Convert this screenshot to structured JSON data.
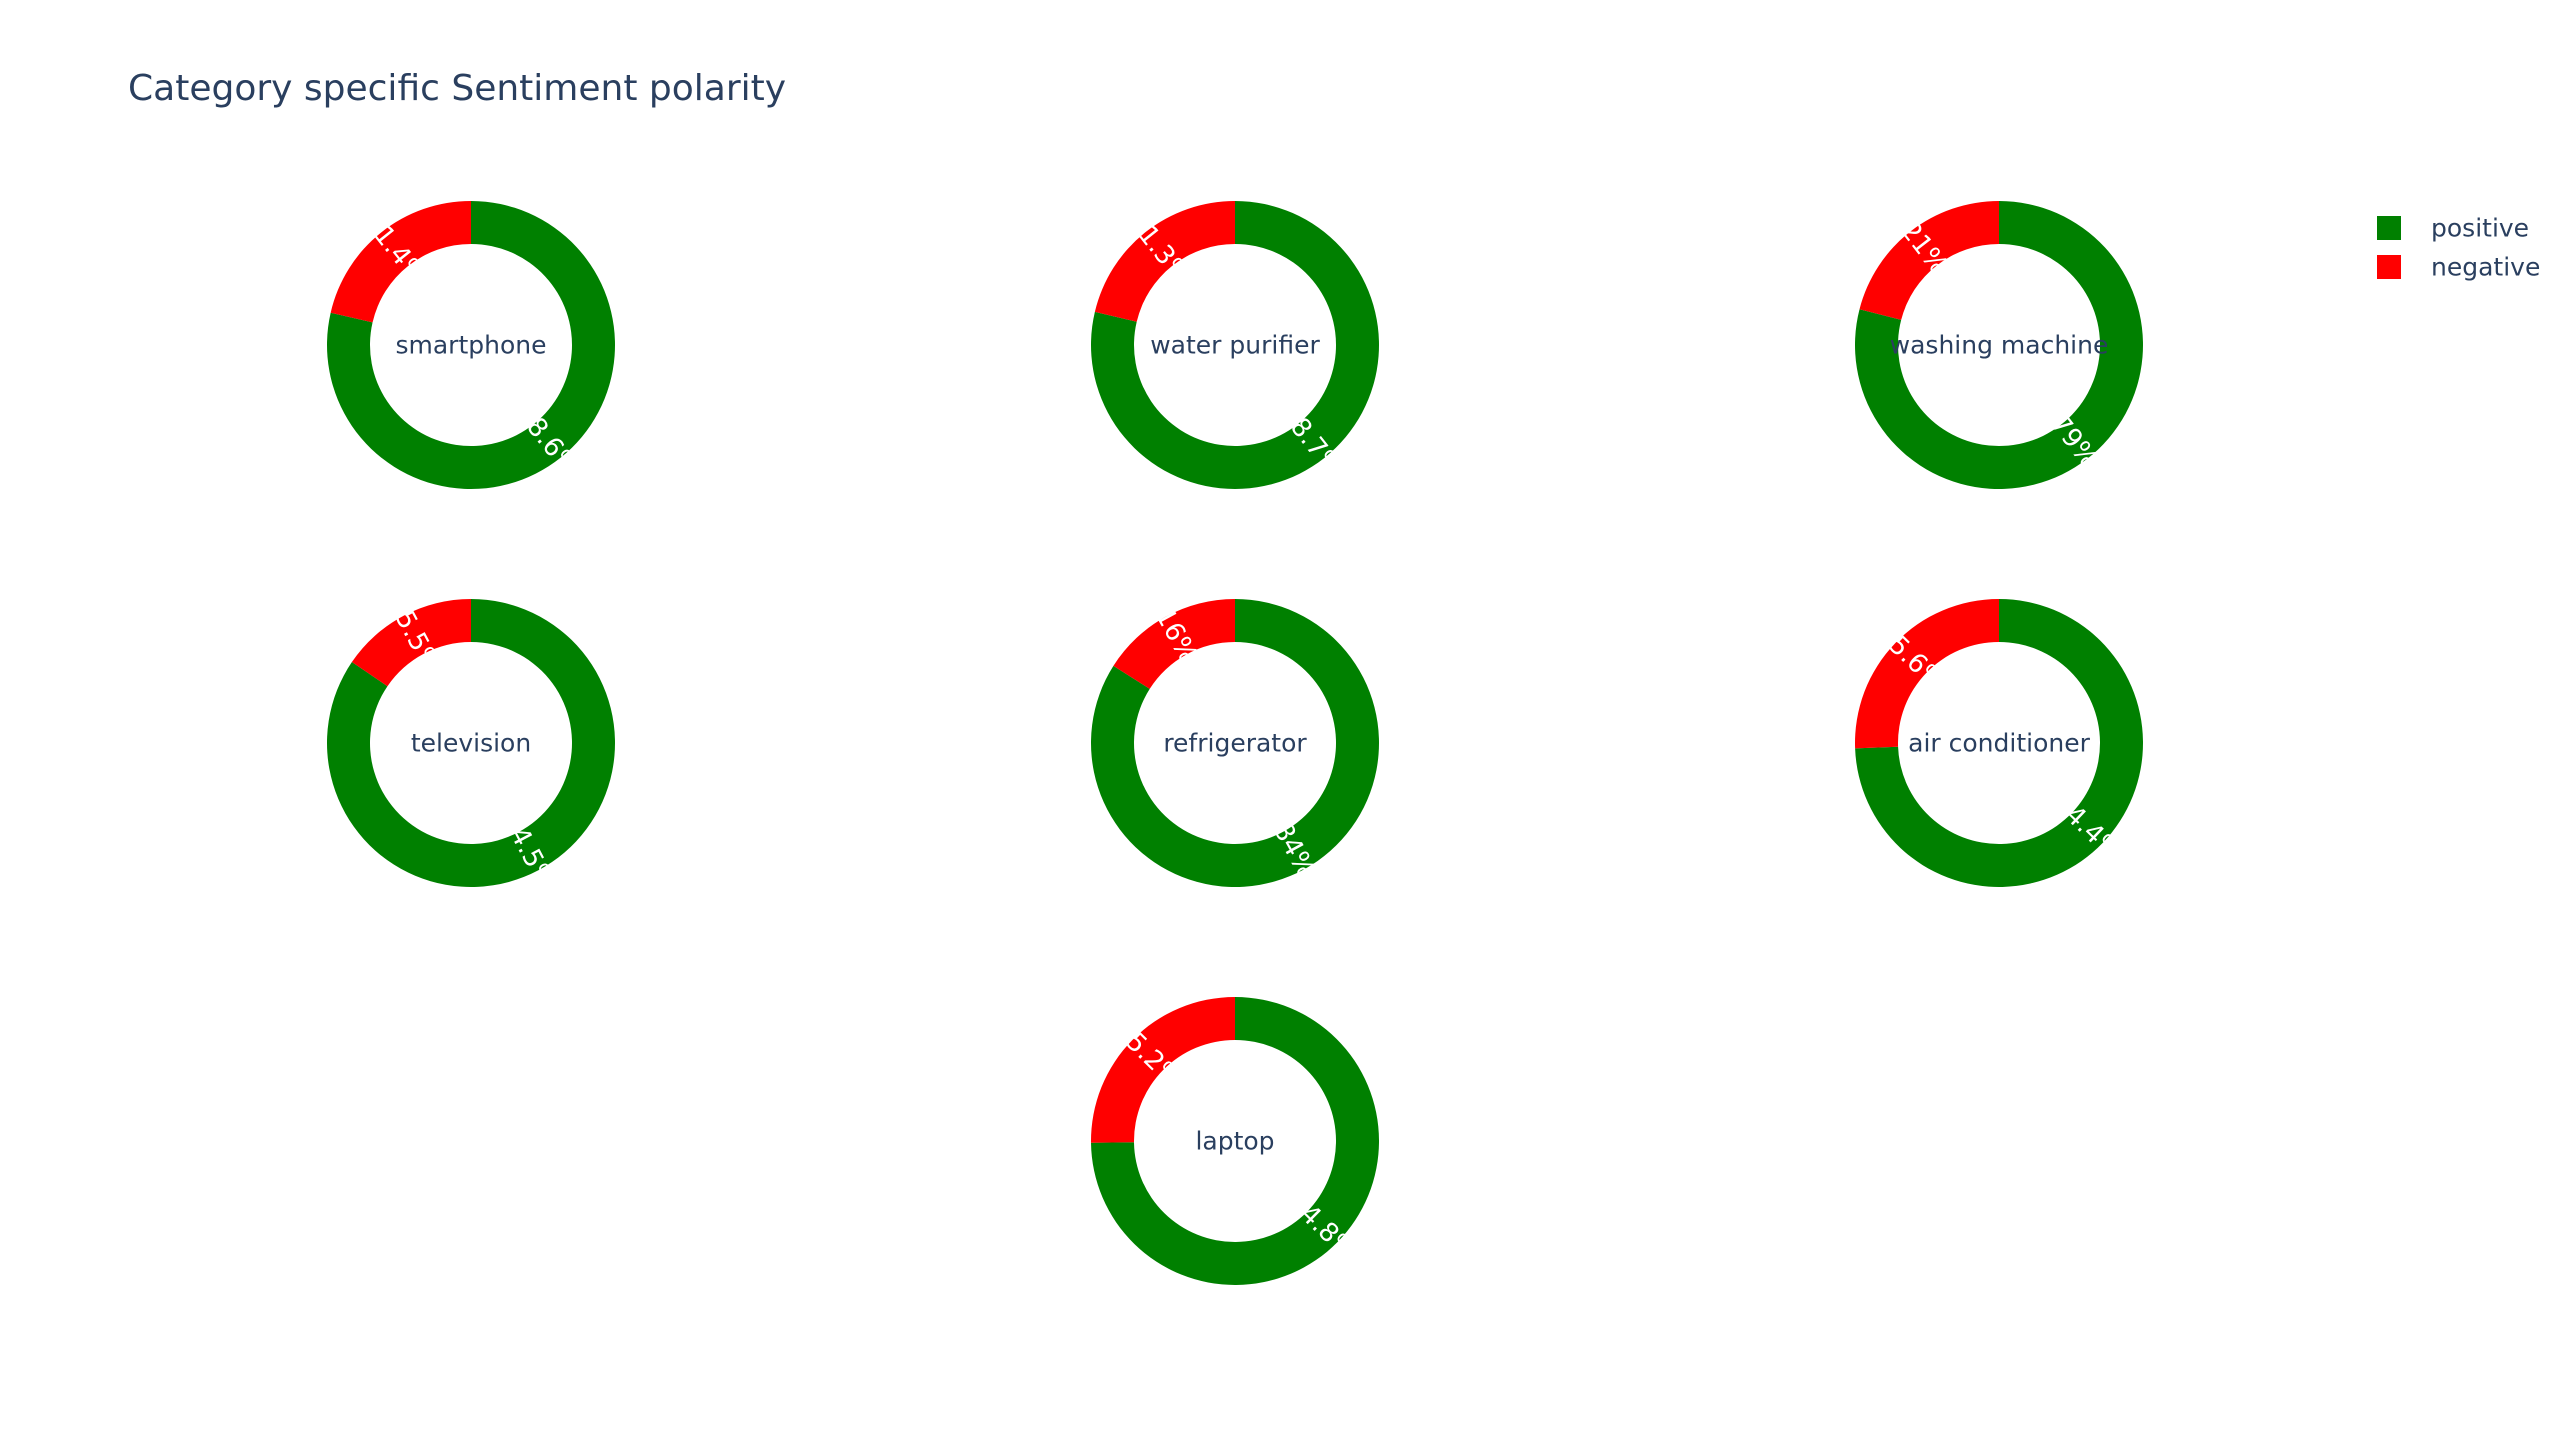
{
  "chart_data": {
    "type": "pie",
    "subtype": "donut",
    "title": "Category specific Sentiment polarity",
    "legend": {
      "position": "top-right",
      "items": [
        {
          "name": "positive",
          "color": "#008000"
        },
        {
          "name": "negative",
          "color": "#ff0000"
        }
      ]
    },
    "labels": [
      "positive",
      "negative"
    ],
    "colors": [
      "#008000",
      "#ff0000"
    ],
    "charts": [
      {
        "category": "smartphone",
        "values": [
          78.6,
          21.4
        ],
        "value_labels": [
          "78.6%",
          "21.4%"
        ]
      },
      {
        "category": "water purifier",
        "values": [
          78.7,
          21.3
        ],
        "value_labels": [
          "78.7%",
          "21.3%"
        ]
      },
      {
        "category": "washing machine",
        "values": [
          79,
          21
        ],
        "value_labels": [
          "79%",
          "21%"
        ]
      },
      {
        "category": "television",
        "values": [
          84.5,
          15.5
        ],
        "value_labels": [
          "84.5%",
          "15.5%"
        ]
      },
      {
        "category": "refrigerator",
        "values": [
          84,
          16
        ],
        "value_labels": [
          "84%",
          "16%"
        ]
      },
      {
        "category": "air conditioner",
        "values": [
          74.4,
          25.6
        ],
        "value_labels": [
          "74.4%",
          "25.6%"
        ]
      },
      {
        "category": "laptop",
        "values": [
          74.8,
          25.2
        ],
        "value_labels": [
          "74.8%",
          "25.2%"
        ]
      }
    ]
  }
}
